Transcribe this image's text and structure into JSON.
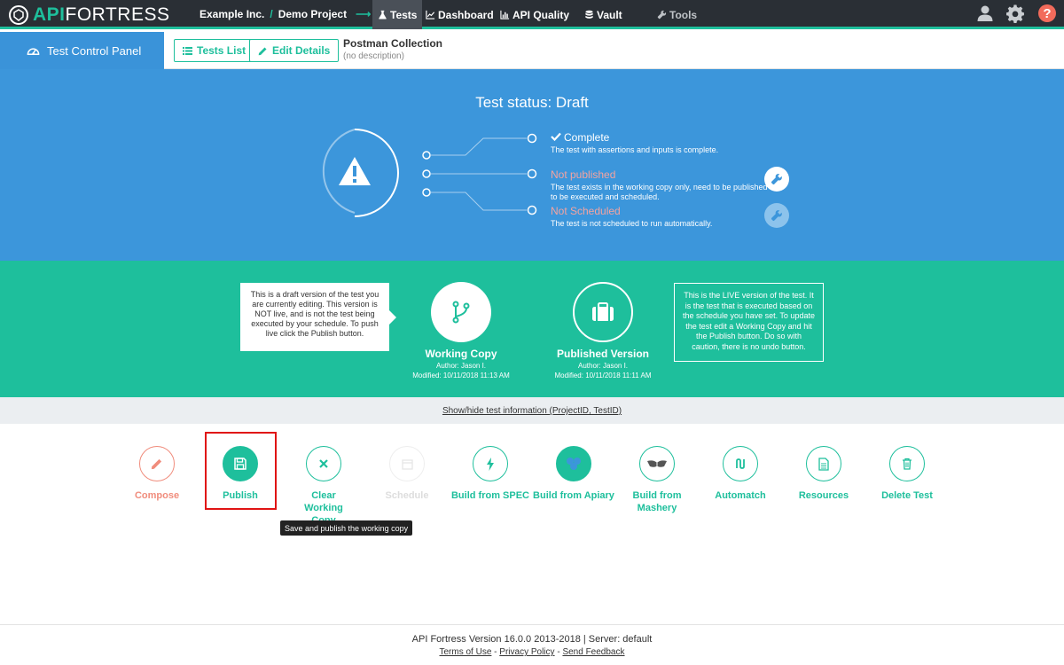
{
  "topnav": {
    "logo_api": "API",
    "logo_fortress": "FORTRESS",
    "company": "Example Inc.",
    "separator": "/",
    "project": "Demo Project",
    "arrow": "⟶",
    "items": [
      {
        "label": "Tests",
        "icon": "flask-icon",
        "active": true
      },
      {
        "label": "Dashboard",
        "icon": "line-chart-icon"
      },
      {
        "label": "API Quality",
        "icon": "bar-chart-icon"
      },
      {
        "label": "Vault",
        "icon": "database-icon"
      },
      {
        "label": "Tools",
        "icon": "wrench-icon"
      }
    ],
    "right_icons": [
      "user-icon",
      "gear-icon",
      "help-icon"
    ]
  },
  "subheader": {
    "panel_label": "Test Control Panel",
    "tests_list_label": "Tests List",
    "edit_details_label": "Edit Details",
    "collection_title": "Postman Collection",
    "collection_desc": "(no description)"
  },
  "status": {
    "title": "Test status: Draft",
    "rows": [
      {
        "label": "Complete",
        "desc": "The test with assertions and inputs is complete."
      },
      {
        "label": "Not published",
        "desc": "The test exists in the working copy only, need to be published to be executed and scheduled."
      },
      {
        "label": "Not Scheduled",
        "desc": "The test is not scheduled to run automatically."
      }
    ]
  },
  "versions": {
    "draft_tip": "This is a draft version of the test you are currently editing. This version is NOT live, and is not the test being executed by your schedule. To push live click the Publish button.",
    "live_tip": "This is the LIVE version of the test. It is the test that is executed based on the schedule you have set. To update the test edit a Working Copy and hit the Publish button. Do so with caution, there is no undo button.",
    "working": {
      "title": "Working Copy",
      "author": "Author: Jason I.",
      "modified": "Modified: 10/11/2018 11:13 AM"
    },
    "published": {
      "title": "Published Version",
      "author": "Author: Jason I.",
      "modified": "Modified: 10/11/2018 11:11 AM"
    }
  },
  "showhide_label": "Show/hide test information (ProjectID, TestID)",
  "actions": [
    {
      "label": "Compose",
      "icon": "pencil-icon"
    },
    {
      "label": "Publish",
      "icon": "save-icon"
    },
    {
      "label": "Clear Working Copy",
      "icon": "close-icon"
    },
    {
      "label": "Schedule",
      "icon": "calendar-icon"
    },
    {
      "label": "Build from SPEC",
      "icon": "bolt-icon"
    },
    {
      "label": "Build from Apiary",
      "icon": "apiary-icon"
    },
    {
      "label": "Build from Mashery",
      "icon": "mashery-icon"
    },
    {
      "label": "Automatch",
      "icon": "automatch-icon"
    },
    {
      "label": "Resources",
      "icon": "document-icon"
    },
    {
      "label": "Delete Test",
      "icon": "trash-icon"
    }
  ],
  "tooltip": "Save and publish the working copy",
  "footer": {
    "version": "API Fortress Version 16.0.0 2013-2018 | Server: default",
    "terms": "Terms of Use",
    "privacy": "Privacy Policy",
    "feedback": "Send Feedback",
    "sep": " - "
  },
  "colors": {
    "teal": "#1ebf9c",
    "blue": "#3c96db",
    "dark": "#2a2f35",
    "warn": "#f4a3a0",
    "compose": "#f08c7c"
  }
}
